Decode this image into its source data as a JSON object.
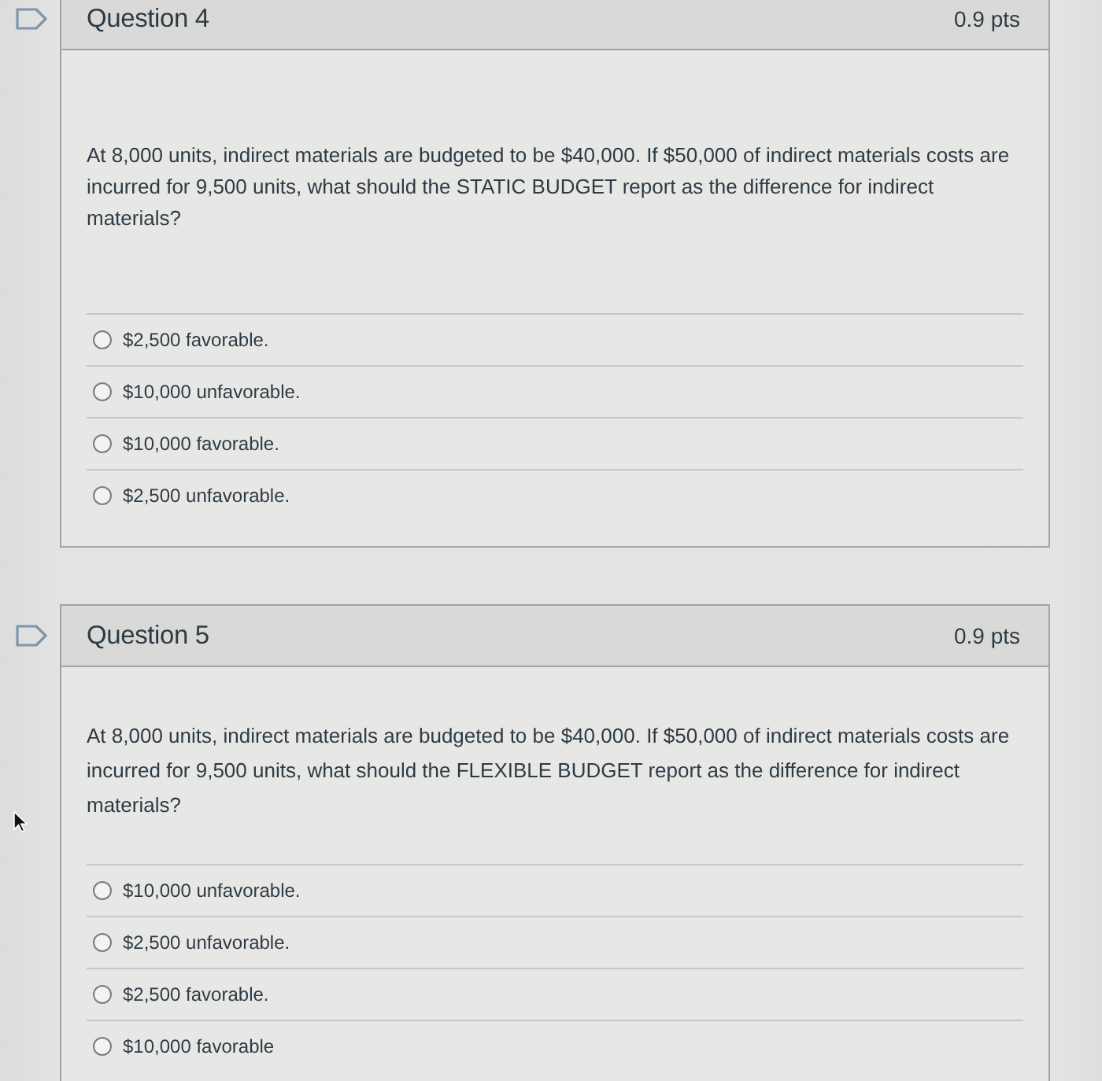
{
  "questions": [
    {
      "title": "Question 4",
      "points": "0.9 pts",
      "flagged": false,
      "text": "At 8,000 units, indirect materials are budgeted to be $40,000. If $50,000 of indirect materials costs are incurred for 9,500 units, what should the STATIC BUDGET report as the difference for indirect materials?",
      "answers": [
        {
          "label": "$2,500 favorable.",
          "selected": false
        },
        {
          "label": "$10,000 unfavorable.",
          "selected": false
        },
        {
          "label": "$10,000 favorable.",
          "selected": false
        },
        {
          "label": "$2,500 unfavorable.",
          "selected": false
        }
      ]
    },
    {
      "title": "Question 5",
      "points": "0.9 pts",
      "flagged": false,
      "text": "At 8,000 units, indirect materials are budgeted to be $40,000. If $50,000 of indirect materials costs are incurred for 9,500 units, what should the FLEXIBLE BUDGET report as the difference for indirect materials?",
      "answers": [
        {
          "label": "$10,000 unfavorable.",
          "selected": false
        },
        {
          "label": "$2,500 unfavorable.",
          "selected": false
        },
        {
          "label": "$2,500 favorable.",
          "selected": false
        },
        {
          "label": "$10,000 favorable",
          "selected": false
        }
      ]
    }
  ]
}
